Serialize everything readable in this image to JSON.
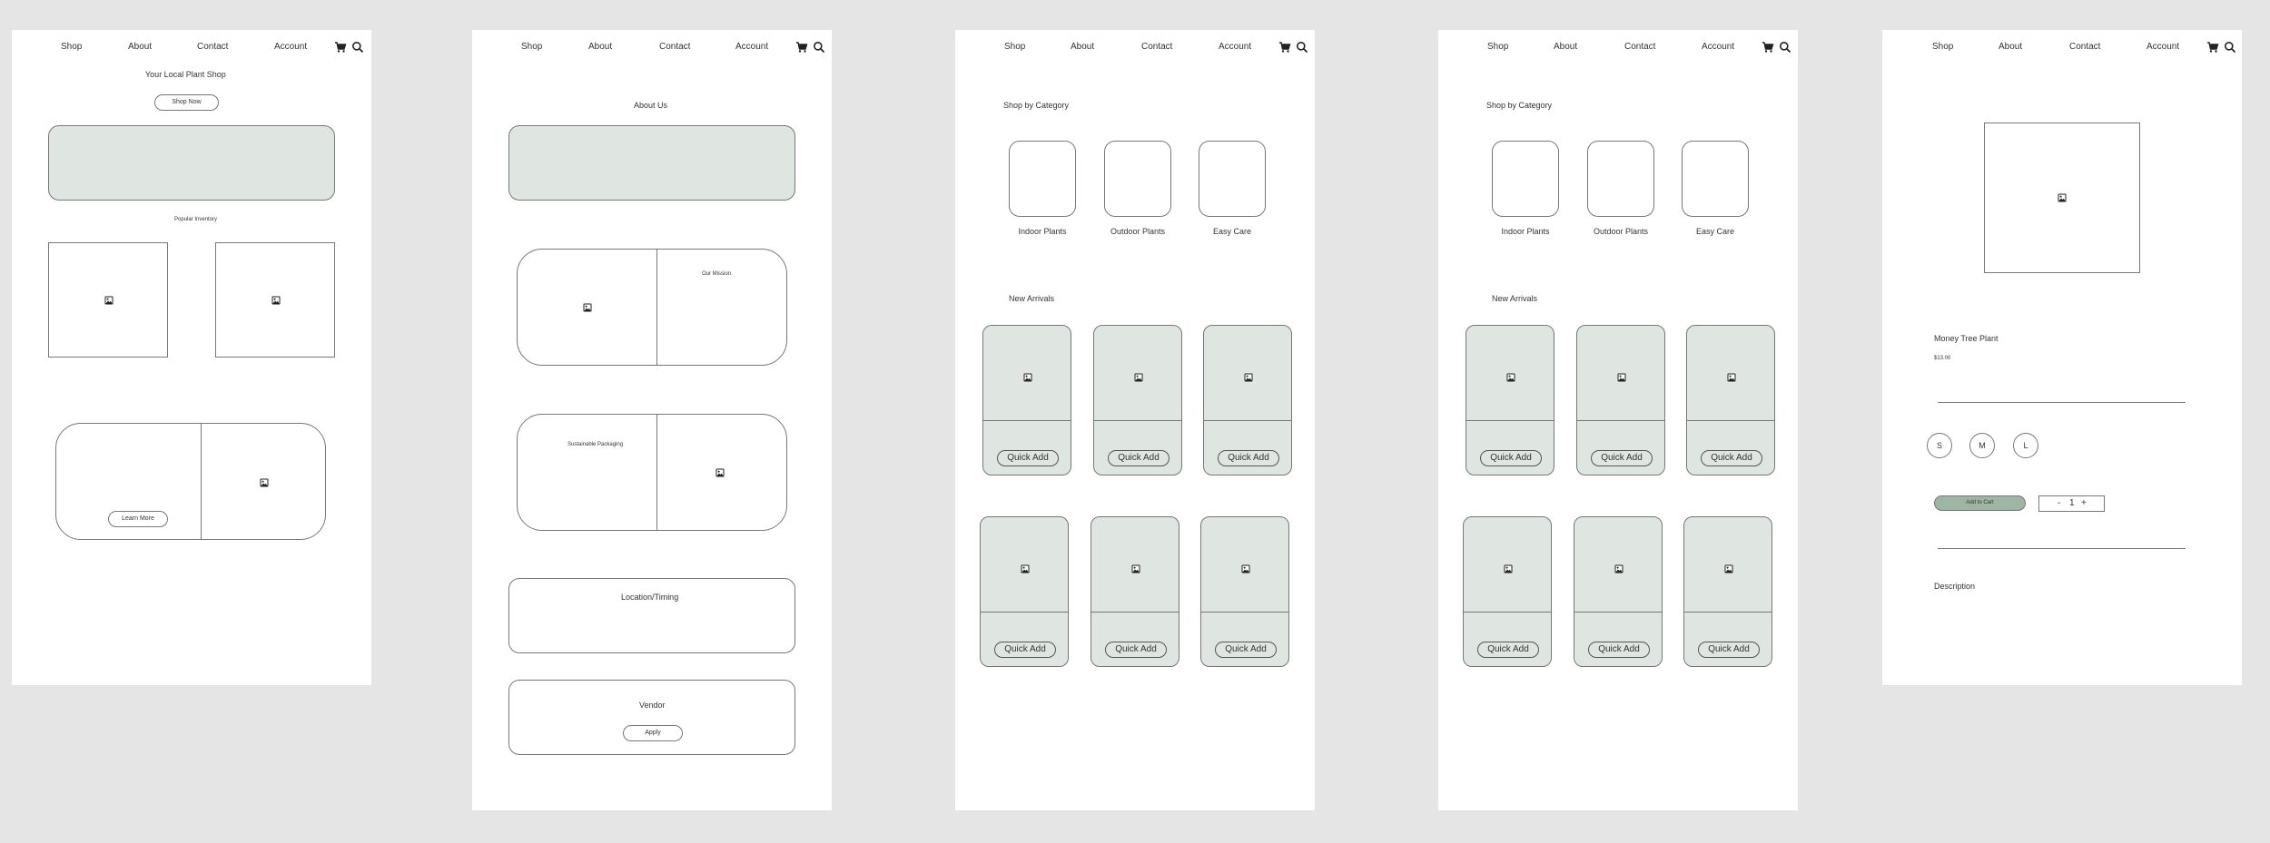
{
  "nav": {
    "shop": "Shop",
    "about": "About",
    "contact": "Contact",
    "account": "Account"
  },
  "home": {
    "title": "Your Local Plant Shop",
    "shop_now": "Shop Now",
    "popular": "Popular Inventory",
    "learn_more": "Learn More"
  },
  "about": {
    "title": "About Us",
    "mission": "Our Mission",
    "packaging": "Sustainable Packaging",
    "location": "Location/Timing",
    "vendor": "Vendor",
    "apply": "Apply"
  },
  "shop": {
    "category_heading": "Shop by Category",
    "categories": [
      "Indoor Plants",
      "Outdoor Plants",
      "Easy Care"
    ],
    "arrivals_heading": "New Arrivals",
    "quick_add": "Quick Add"
  },
  "product": {
    "name": "Money Tree Plant",
    "price": "$13.00",
    "sizes": [
      "S",
      "M",
      "L"
    ],
    "add_to_cart": "Add to Cart",
    "qty_minus": "-",
    "qty_value": "1",
    "qty_plus": "+",
    "description": "Description"
  },
  "colors": {
    "accent_green": "#9db5a3",
    "panel_green": "#dfe5e1"
  }
}
